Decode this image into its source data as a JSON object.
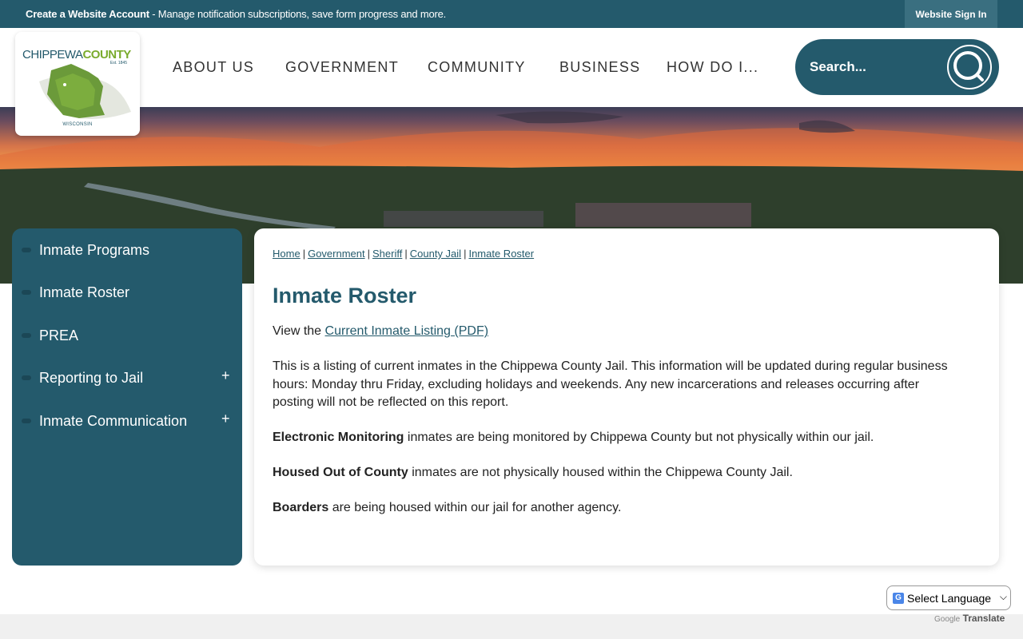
{
  "topbar": {
    "create_bold": "Create a Website Account",
    "create_rest": " - Manage notification subscriptions, save form progress and more.",
    "signin": "Website Sign In"
  },
  "logo": {
    "name_part1": "CHIPPEWA",
    "name_part2": "COUNTY",
    "est": "Est. 1845",
    "state": "WISCONSIN"
  },
  "nav": {
    "items": [
      "ABOUT US",
      "GOVERNMENT",
      "COMMUNITY",
      "BUSINESS",
      "HOW DO I..."
    ]
  },
  "search": {
    "placeholder": "Search..."
  },
  "sidebar": {
    "items": [
      {
        "label": "Inmate Programs",
        "expandable": false
      },
      {
        "label": "Inmate Roster",
        "expandable": false
      },
      {
        "label": "PREA",
        "expandable": false
      },
      {
        "label": "Reporting to Jail",
        "expandable": true
      },
      {
        "label": "Inmate Communication",
        "expandable": true
      }
    ]
  },
  "breadcrumb": [
    "Home",
    "Government",
    "Sheriff",
    "County Jail",
    "Inmate Roster"
  ],
  "content": {
    "title": "Inmate Roster",
    "view_prefix": "View the ",
    "view_link": "Current Inmate Listing (PDF)",
    "intro": "This is a listing of current inmates in the Chippewa County Jail. This information will be updated during regular business hours: Monday thru Friday, excluding holidays and weekends. Any new incarcerations and releases occurring after posting will not be reflected on this report.",
    "em_bold": "Electronic Monitoring",
    "em_rest": " inmates are being monitored by Chippewa County but not physically within our jail.",
    "ho_bold": "Housed Out of County",
    "ho_rest": " inmates are not physically housed within the Chippewa County Jail.",
    "bo_bold": "Boarders",
    "bo_rest": " are being housed within our jail for another agency."
  },
  "translate": {
    "select_label": "Select Language",
    "powered_google": "Google",
    "powered_translate": "Translate"
  },
  "colors": {
    "brand_teal": "#245a6c",
    "logo_green": "#7aab2d"
  }
}
